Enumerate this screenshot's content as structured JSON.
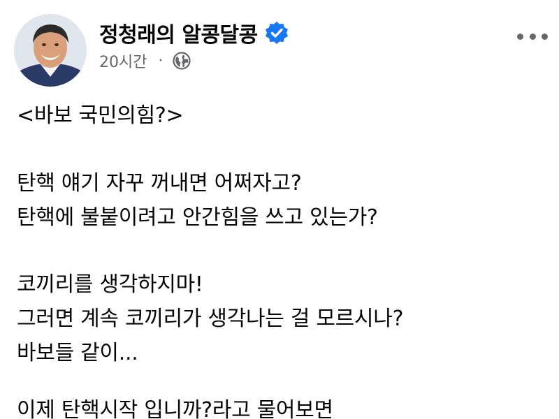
{
  "post": {
    "author": "정청래의 알콩달콩",
    "time": "20시간",
    "separator": "·",
    "privacy_icon": "globe-icon",
    "verified_icon": "verified-badge-icon",
    "more_icon": "more-options-icon",
    "verified_color": "#1877f2",
    "lines": [
      "<바보 국민의힘?>",
      "탄핵 얘기 자꾸 꺼내면 어쩌자고?",
      "탄핵에 불붙이려고 안간힘을 쓰고 있는가?",
      "코끼리를 생각하지마!",
      "그러면 계속 코끼리가 생각나는 걸 모르시나?",
      "바보들 같이...",
      "이제 탄핵시작 입니까?라고 물어보면"
    ]
  }
}
